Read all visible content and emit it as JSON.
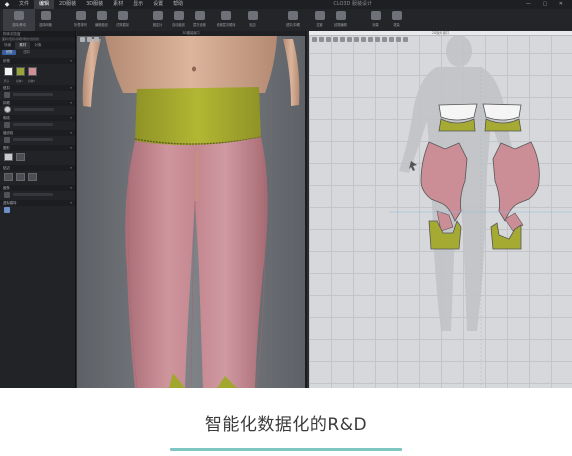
{
  "app": {
    "menu": [
      "文件",
      "编辑",
      "2D服装",
      "3D服装",
      "素材",
      "显示",
      "设置",
      "帮助"
    ],
    "active_menu": "编辑",
    "window_title": "CLO3D 服装设计",
    "window_buttons": "— ▢ ✕"
  },
  "toolbar": {
    "tools": [
      {
        "label": "选择/移动",
        "icon": "select-icon"
      },
      {
        "label": "选择网格",
        "icon": "mesh-icon"
      },
      {
        "label": "折叠排列",
        "icon": "fold-icon"
      },
      {
        "label": "编辑缝纫",
        "icon": "sewing-icon"
      },
      {
        "label": "试穿模拟",
        "icon": "simulate-icon"
      },
      {
        "label": "固定针",
        "icon": "pin-icon"
      },
      {
        "label": "自动缝纫",
        "icon": "auto-sew-icon"
      },
      {
        "label": "层次设置",
        "icon": "layer-icon"
      },
      {
        "label": "设置层次顺序",
        "icon": "layer-order-icon"
      },
      {
        "label": "贴边",
        "icon": "edge-icon"
      },
      {
        "label": "纽扣/扣眼",
        "icon": "button-icon"
      },
      {
        "label": "拉链",
        "icon": "zipper-icon"
      },
      {
        "label": "纹理编辑",
        "icon": "texture-icon"
      },
      {
        "label": "测量",
        "icon": "measure-icon"
      },
      {
        "label": "渲染",
        "icon": "render-icon"
      }
    ]
  },
  "left_panel": {
    "header": "物体浏览窗",
    "path": "面料/纽扣/扣眼/明线/缝纫线",
    "tabs": [
      "场景",
      "素材",
      "对象"
    ],
    "active_tab": "素材",
    "sub_tabs": [
      "织物",
      "纽扣"
    ],
    "sections": [
      "织物",
      "纽扣",
      "扣眼",
      "明线",
      "缝纫线",
      "图形",
      "贴边",
      "嵌条",
      "虚拟模特"
    ],
    "fabric_swatch_colors": [
      "#f2f2f2",
      "#9aa537",
      "#cf8f98"
    ],
    "fabric_labels": [
      "默认",
      "织物1",
      "织物2"
    ]
  },
  "view3d": {
    "header": "3D服装窗口",
    "fabric_main": "#c98a93",
    "fabric_band": "#a7ab2d",
    "skin": "#d9b29a"
  },
  "view2d": {
    "header": "2D版片窗口"
  },
  "caption": {
    "text": "智能化数据化的R&D",
    "accent": "#7fc6c2"
  }
}
